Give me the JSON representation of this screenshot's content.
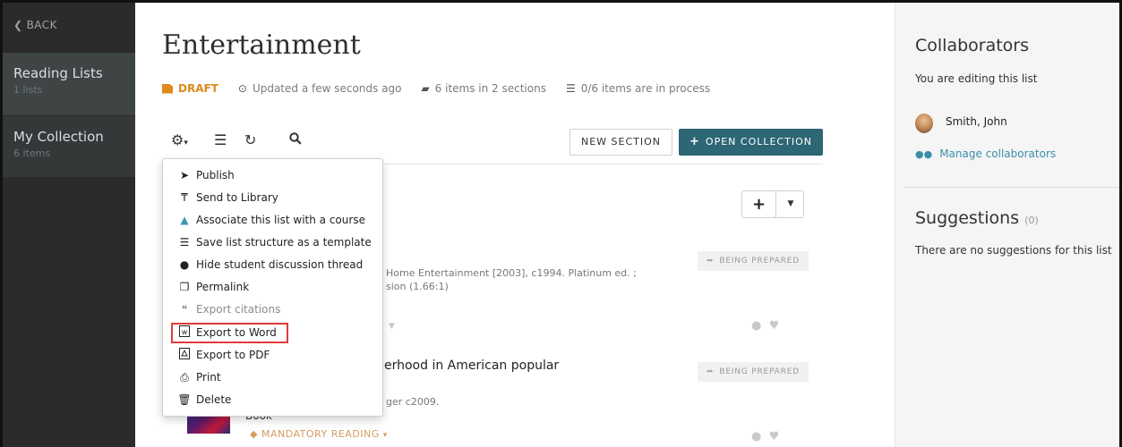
{
  "sidebar": {
    "back_label": "BACK",
    "items": [
      {
        "title": "Reading Lists",
        "subtitle": "1 lists"
      },
      {
        "title": "My Collection",
        "subtitle": "6 items"
      }
    ]
  },
  "main": {
    "title": "Entertainment",
    "meta": {
      "draft_label": "DRAFT",
      "updated": "Updated a few seconds ago",
      "items": "6 items in 2 sections",
      "in_process": "0/6 items are in process"
    },
    "toolbar": {
      "new_section_label": "NEW SECTION",
      "open_collection_label": "OPEN COLLECTION"
    },
    "items": [
      {
        "status": "BEING PREPARED",
        "line1": "Home Entertainment [2003], c1994. Platinum ed. ;",
        "line2": "sion (1.66:1)"
      },
      {
        "status": "BEING PREPARED",
        "title_fragment": "erhood in American popular",
        "line1": "ger c2009.",
        "type_fragment": "Book",
        "tag": "MANDATORY READING"
      }
    ]
  },
  "menu": {
    "items": [
      {
        "label": "Publish",
        "icon": "paper-plane-icon"
      },
      {
        "label": "Send to Library",
        "icon": "pin-icon"
      },
      {
        "label": "Associate this list with a course",
        "icon": "graduation-cap-icon"
      },
      {
        "label": "Save list structure as a template",
        "icon": "list-ordered-icon"
      },
      {
        "label": "Hide student discussion thread",
        "icon": "comments-icon"
      },
      {
        "label": "Permalink",
        "icon": "copy-icon"
      },
      {
        "label": "Export citations",
        "icon": "quote-icon"
      },
      {
        "label": "Export to Word",
        "icon": "word-file-icon"
      },
      {
        "label": "Export to PDF",
        "icon": "pdf-file-icon"
      },
      {
        "label": "Print",
        "icon": "print-icon"
      },
      {
        "label": "Delete",
        "icon": "trash-icon"
      }
    ]
  },
  "right": {
    "collaborators_title": "Collaborators",
    "editing_text": "You are editing this list",
    "collaborator_name": "Smith, John",
    "manage_label": "Manage collaborators",
    "suggestions_title": "Suggestions",
    "suggestions_count": "(0)",
    "suggestions_empty": "There are no suggestions for this list"
  },
  "colors": {
    "sidebar_bg": "#2b2b2b",
    "accent_teal": "#2d6674",
    "draft_orange": "#e0891a",
    "highlight_red": "#e03a3a"
  }
}
